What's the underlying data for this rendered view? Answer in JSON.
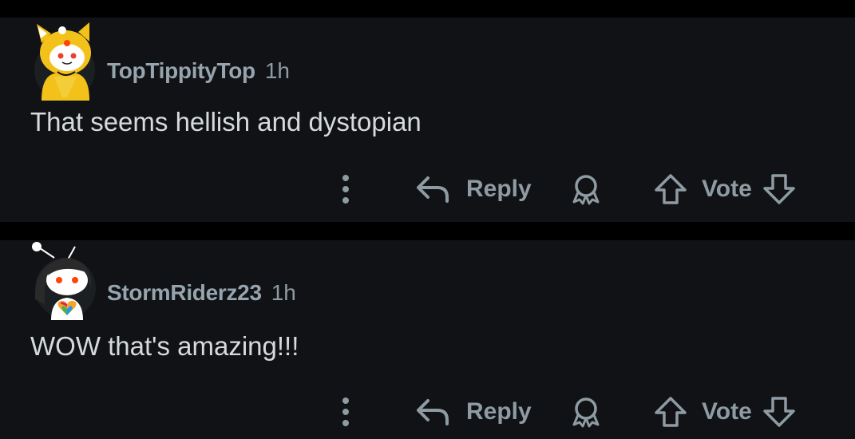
{
  "comments": [
    {
      "author": "TopTippityTop",
      "age": "1h",
      "text": "That seems hellish and dystopian",
      "avatar_icon": "snoo-shiba-costume-avatar"
    },
    {
      "author": "StormRiderz23",
      "age": "1h",
      "text": "WOW that's amazing!!!",
      "avatar_icon": "snoo-long-hair-heart-avatar"
    }
  ],
  "actions": {
    "reply_label": "Reply",
    "vote_label": "Vote"
  },
  "colors": {
    "background": "#000000",
    "card": "#101215",
    "text": "#d7dadc",
    "muted": "#8f9ba3"
  }
}
